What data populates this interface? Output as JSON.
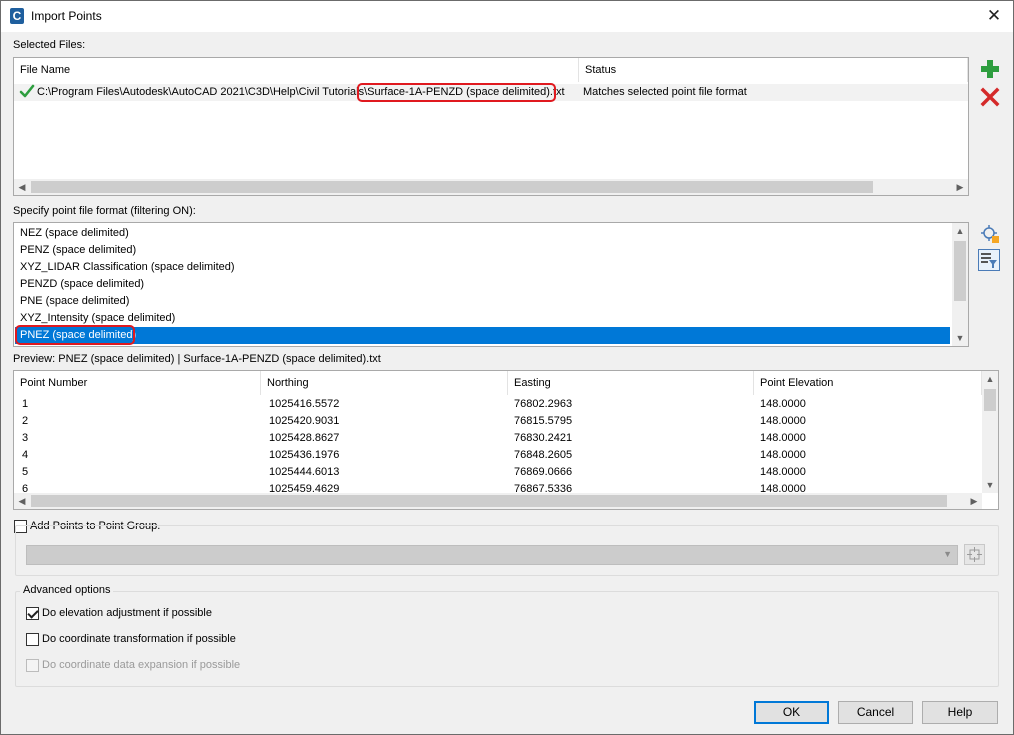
{
  "window": {
    "title": "Import Points",
    "app_icon_letter": "C"
  },
  "selected_files": {
    "label": "Selected Files:",
    "columns": [
      "File Name",
      "Status"
    ],
    "rows": [
      {
        "path_prefix": "C:\\Program Files\\Autodesk\\AutoCAD 2021\\C3D\\Help\\Civil Tutorials\\",
        "file_name": "Surface-1A-PENZD (space delimited).txt",
        "status": "Matches selected point file format"
      }
    ]
  },
  "format": {
    "label": "Specify point file format (filtering ON):",
    "items": [
      "NEZ (space delimited)",
      "PENZ (space delimited)",
      "XYZ_LIDAR Classification (space delimited)",
      "PENZD (space delimited)",
      "PNE (space delimited)",
      "XYZ_Intensity (space delimited)",
      "PNEZ (space delimited)"
    ],
    "selected_index": 6
  },
  "preview": {
    "label": "Preview: PNEZ (space delimited) | Surface-1A-PENZD (space delimited).txt",
    "columns": [
      "Point Number",
      "Northing",
      "Easting",
      "Point Elevation"
    ],
    "rows": [
      [
        "1",
        "1025416.5572",
        "76802.2963",
        "148.0000"
      ],
      [
        "2",
        "1025420.9031",
        "76815.5795",
        "148.0000"
      ],
      [
        "3",
        "1025428.8627",
        "76830.2421",
        "148.0000"
      ],
      [
        "4",
        "1025436.1976",
        "76848.2605",
        "148.0000"
      ],
      [
        "5",
        "1025444.6013",
        "76869.0666",
        "148.0000"
      ],
      [
        "6",
        "1025459.4629",
        "76867.5336",
        "148.0000"
      ]
    ]
  },
  "point_group": {
    "label": "Add Points to Point Group.",
    "checked": false
  },
  "advanced": {
    "legend": "Advanced options",
    "options": [
      {
        "label": "Do elevation adjustment if possible",
        "checked": true,
        "enabled": true
      },
      {
        "label": "Do coordinate transformation if possible",
        "checked": false,
        "enabled": true
      },
      {
        "label": "Do coordinate data expansion if possible",
        "checked": false,
        "enabled": false
      }
    ]
  },
  "buttons": {
    "ok": "OK",
    "cancel": "Cancel",
    "help": "Help"
  },
  "icons": {
    "add": "plus-icon",
    "remove": "delete-x-icon",
    "add_format": "add-format-icon",
    "manage_formats": "filter-formats-icon",
    "group_pick": "pick-group-icon"
  },
  "colors": {
    "highlight": "#0078d7",
    "annotation": "#e0191f",
    "check_green": "#2e9e3f",
    "remove_red": "#d42a2a"
  }
}
